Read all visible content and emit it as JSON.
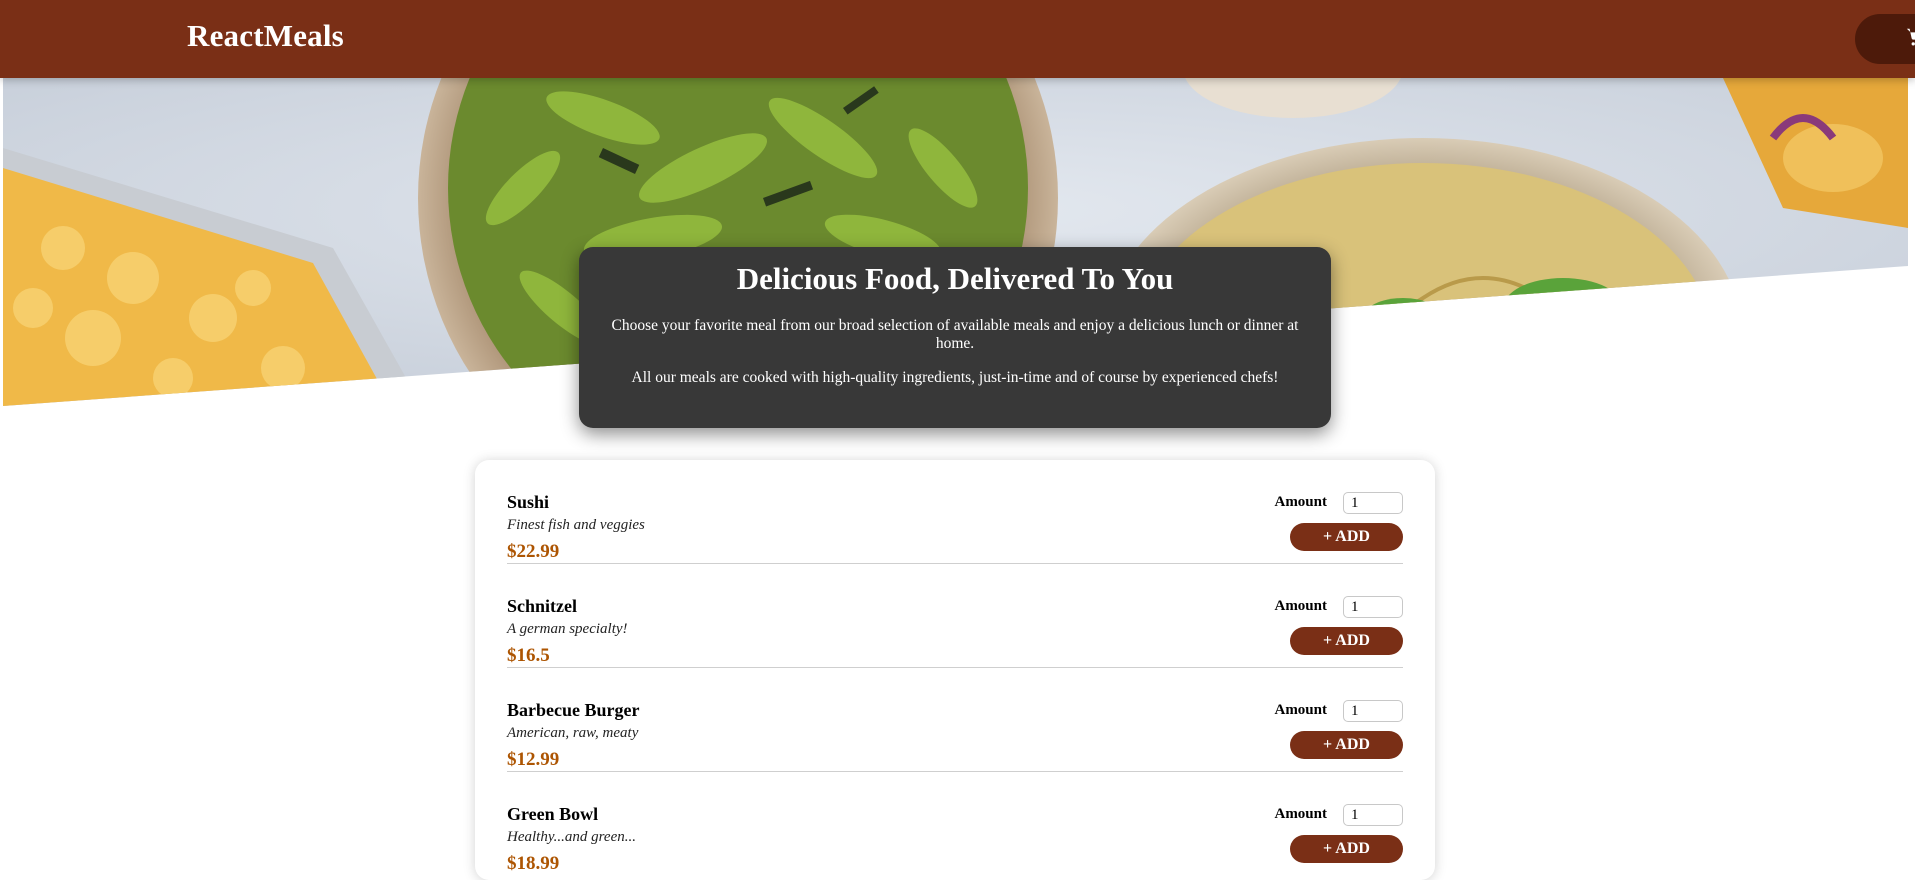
{
  "header": {
    "brand": "ReactMeals",
    "cart_icon": "cart-icon"
  },
  "summary": {
    "title": "Delicious Food, Delivered To You",
    "paragraph1": "Choose your favorite meal from our broad selection of available meals and enjoy a delicious lunch or dinner at home.",
    "paragraph2": "All our meals are cooked with high-quality ingredients, just-in-time and of course by experienced chefs!"
  },
  "meals": [
    {
      "name": "Sushi",
      "description": "Finest fish and veggies",
      "price": "$22.99",
      "amount_label": "Amount",
      "amount_value": "1",
      "add_label": "+ ADD"
    },
    {
      "name": "Schnitzel",
      "description": "A german specialty!",
      "price": "$16.5",
      "amount_label": "Amount",
      "amount_value": "1",
      "add_label": "+ ADD"
    },
    {
      "name": "Barbecue Burger",
      "description": "American, raw, meaty",
      "price": "$12.99",
      "amount_label": "Amount",
      "amount_value": "1",
      "add_label": "+ ADD"
    },
    {
      "name": "Green Bowl",
      "description": "Healthy...and green...",
      "price": "$18.99",
      "amount_label": "Amount",
      "amount_value": "1",
      "add_label": "+ ADD"
    }
  ],
  "colors": {
    "header": "#7a2f16",
    "cart_button": "#4d1a0a",
    "price": "#ad5502",
    "summary_bg": "#383838"
  }
}
